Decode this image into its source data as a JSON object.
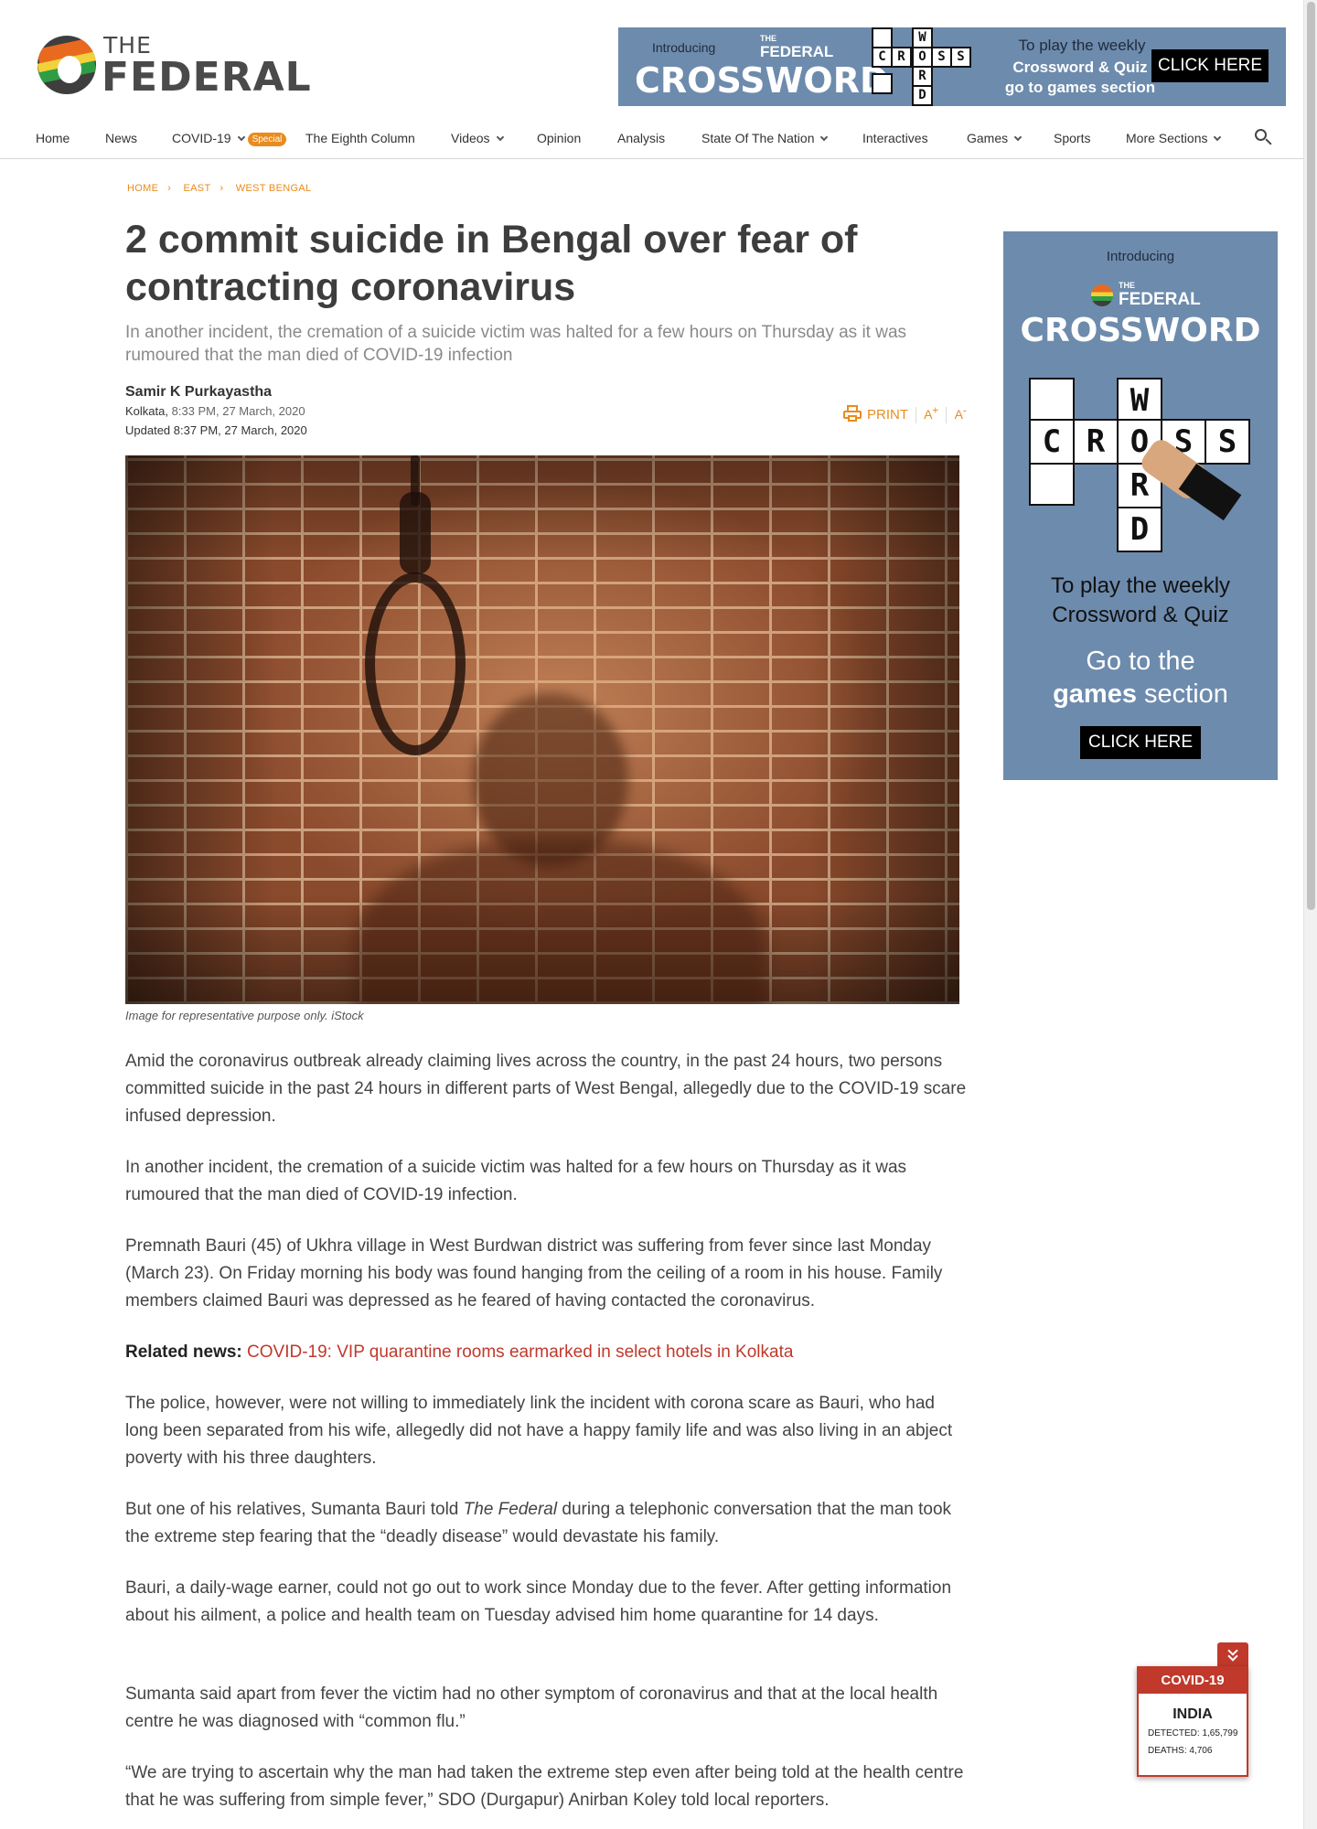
{
  "brand": {
    "the": "THE",
    "name": "FEDERAL"
  },
  "top_ad": {
    "intro": "Introducing",
    "mini_the": "THE",
    "mini_name": "FEDERAL",
    "title": "CROSSWORD",
    "line1": "To play the weekly",
    "line2": "Crossword & Quiz",
    "line3": "go to games section",
    "button": "CLICK HERE"
  },
  "nav": {
    "items": [
      {
        "label": "Home"
      },
      {
        "label": "News"
      },
      {
        "label": "COVID-19",
        "badge": "Special"
      },
      {
        "label": "The Eighth Column"
      },
      {
        "label": "Videos"
      },
      {
        "label": "Opinion"
      },
      {
        "label": "Analysis"
      },
      {
        "label": "State Of The Nation"
      },
      {
        "label": "Interactives"
      },
      {
        "label": "Games"
      },
      {
        "label": "Sports"
      },
      {
        "label": "More Sections"
      }
    ]
  },
  "breadcrumb": [
    "HOME",
    "EAST",
    "WEST BENGAL"
  ],
  "article": {
    "title": "2 commit suicide in Bengal over fear of contracting coronavirus",
    "subtitle": "In another incident, the cremation of a suicide victim was halted for a few hours on Thursday as it was rumoured that the man died of COVID-19 infection",
    "author": "Samir K Purkayastha",
    "location": "Kolkata,",
    "published": " 8:33 PM, 27 March, 2020",
    "updated": "Updated 8:37 PM, 27 March, 2020",
    "tools": {
      "print": "PRINT",
      "font_up": "A",
      "font_down": "A"
    },
    "image_caption": "Image for representative purpose only. iStock",
    "paragraphs": [
      "Amid the coronavirus outbreak already claiming lives across the country, in the past 24 hours, two persons committed suicide in the past 24 hours in different parts of West Bengal, allegedly due to the COVID-19 scare infused depression.",
      "In another incident, the cremation of a suicide victim was halted for a few hours on Thursday as it was rumoured that the man died of COVID-19 infection.",
      "Premnath Bauri (45) of Ukhra village in West Burdwan district was suffering from fever since last Monday (March 23). On Friday morning his body was found hanging from the ceiling of a room in his house. Family members claimed Bauri was depressed as he feared of having contacted the coronavirus."
    ],
    "related": {
      "label": "Related news:",
      "link": "COVID-19: VIP quarantine rooms earmarked in select hotels in Kolkata"
    },
    "paragraphs2": [
      "The police, however, were not willing to immediately link the incident with corona scare as Bauri, who had long been separated from his wife, allegedly did not have a happy family life and was also living in an abject poverty with his three daughters."
    ],
    "p_federal": {
      "before": "But one of his relatives, Sumanta Bauri told ",
      "em": "The Federal",
      "after": " during a telephonic conversation that the man took the extreme step fearing that the “deadly disease” would devastate his family."
    },
    "paragraphs3": [
      "Bauri, a daily-wage earner, could not go out to work since Monday due to the fever. After getting information about his ailment, a police and health team on Tuesday advised him home quarantine for 14 days.",
      "Sumanta said apart from fever the victim had no other symptom of coronavirus and that at the local health centre he was diagnosed with “common flu.”",
      "“We are trying to ascertain why the man had taken the extreme step even after being told at the health centre that he was suffering from simple fever,” SDO (Durgapur) Anirban Koley told local reporters."
    ]
  },
  "side_ad": {
    "intro": "Introducing",
    "the": "THE",
    "name": "FEDERAL",
    "title": "CROSSWORD",
    "line1": "To play the weekly",
    "line2": "Crossword & Quiz",
    "line3a": "Go to the",
    "line3b": "games",
    "line3c": " section",
    "button": "CLICK HERE",
    "crossword_across": [
      "C",
      "R",
      "O",
      "S",
      "S"
    ],
    "crossword_down": [
      "W",
      "O",
      "R",
      "D"
    ]
  },
  "covid_widget": {
    "header": "COVID-19",
    "country": "INDIA",
    "detected": "DETECTED: 1,65,799",
    "deaths": "DEATHS: 4,706"
  },
  "colors": {
    "accent": "#e98b1d",
    "ad_bg": "#6d8bad",
    "covid_red": "#c0392b",
    "link": "#c0392b"
  }
}
